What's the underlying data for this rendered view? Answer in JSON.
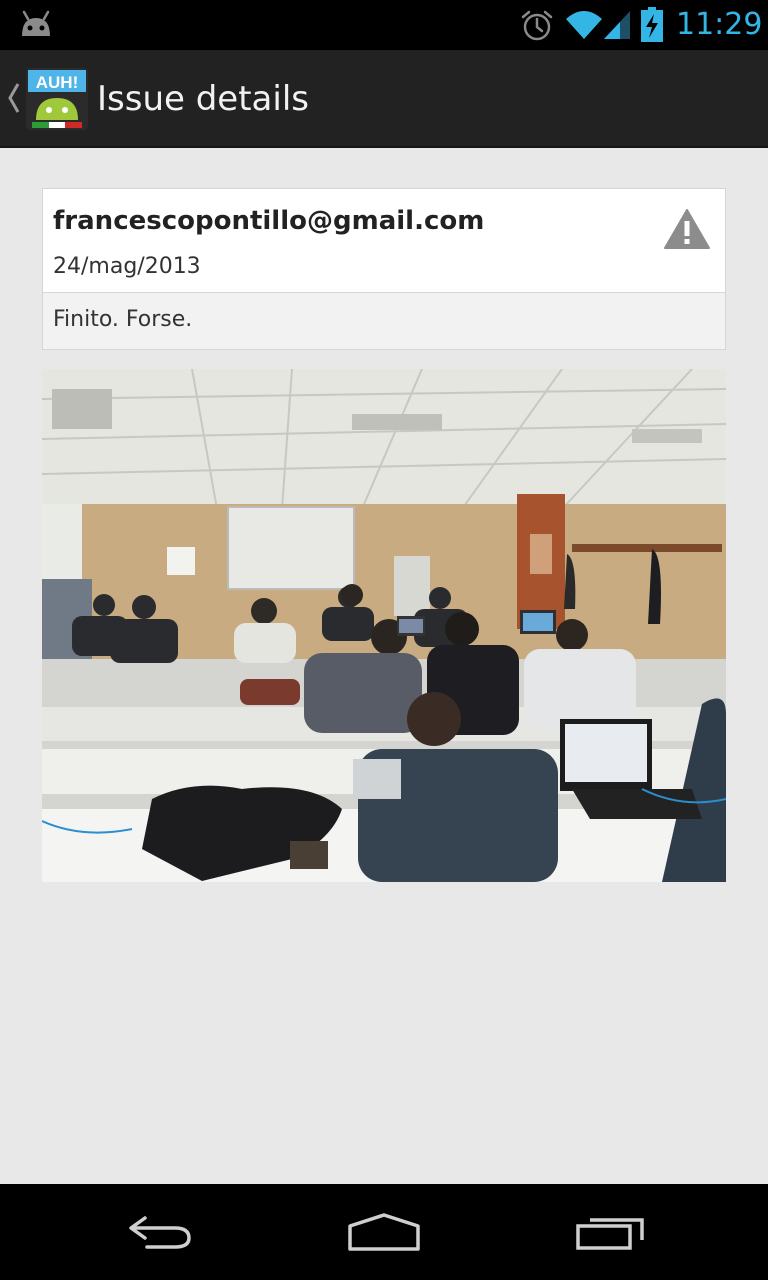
{
  "status_bar": {
    "time": "11:29",
    "icons": [
      "android-icon",
      "alarm-icon",
      "wifi-icon",
      "signal-icon",
      "battery-charging-icon"
    ],
    "accent_color": "#33b5e5"
  },
  "action_bar": {
    "title": "Issue details",
    "app_icon_text": "AUH!",
    "icons": [
      "up-caret-icon",
      "app-icon"
    ]
  },
  "issue": {
    "author": "francescopontillo@gmail.com",
    "date": "24/mag/2013",
    "comment": "Finito. Forse.",
    "status_icon": "warning-icon"
  },
  "photo": {
    "subject": "classroom-photo"
  },
  "nav_bar": {
    "icons": [
      "back-icon",
      "home-icon",
      "recent-apps-icon"
    ]
  }
}
